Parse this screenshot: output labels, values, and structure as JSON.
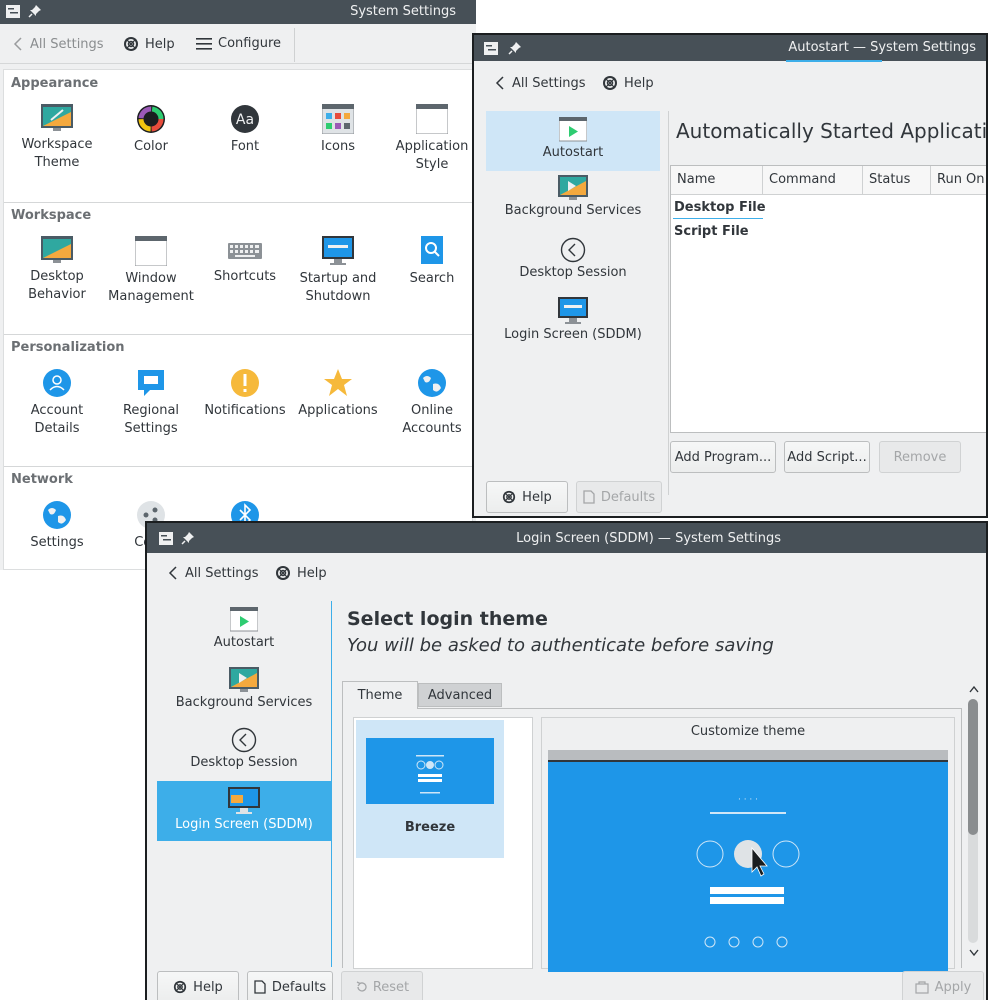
{
  "main_window": {
    "title": "System Settings",
    "toolbar": {
      "back_label": "All Settings",
      "help_label": "Help",
      "configure_label": "Configure"
    },
    "sections": [
      {
        "title": "Appearance",
        "items": [
          {
            "label": "Workspace Theme",
            "icon": "workspace-theme-icon"
          },
          {
            "label": "Color",
            "icon": "color-wheel-icon"
          },
          {
            "label": "Font",
            "icon": "font-icon"
          },
          {
            "label": "Icons",
            "icon": "icons-icon"
          },
          {
            "label": "Application Style",
            "icon": "application-style-icon"
          }
        ]
      },
      {
        "title": "Workspace",
        "items": [
          {
            "label": "Desktop Behavior",
            "icon": "desktop-behavior-icon"
          },
          {
            "label": "Window Management",
            "icon": "window-management-icon"
          },
          {
            "label": "Shortcuts",
            "icon": "keyboard-icon"
          },
          {
            "label": "Startup and Shutdown",
            "icon": "monitor-icon"
          },
          {
            "label": "Search",
            "icon": "search-icon"
          }
        ]
      },
      {
        "title": "Personalization",
        "items": [
          {
            "label": "Account Details",
            "icon": "account-icon"
          },
          {
            "label": "Regional Settings",
            "icon": "chat-flag-icon"
          },
          {
            "label": "Notifications",
            "icon": "notification-icon"
          },
          {
            "label": "Applications",
            "icon": "star-icon"
          },
          {
            "label": "Online Accounts",
            "icon": "globe-icon"
          }
        ]
      },
      {
        "title": "Network",
        "items": [
          {
            "label": "Settings",
            "icon": "network-globe-icon"
          },
          {
            "label": "Conn",
            "icon": "connections-icon"
          },
          {
            "label": "",
            "icon": "bluetooth-icon"
          }
        ]
      }
    ]
  },
  "autostart_window": {
    "title": "Autostart — System Settings",
    "toolbar": {
      "back_label": "All Settings",
      "help_label": "Help"
    },
    "sidebar": [
      {
        "label": "Autostart",
        "icon": "autostart-icon"
      },
      {
        "label": "Background Services",
        "icon": "background-services-icon"
      },
      {
        "label": "Desktop Session",
        "icon": "desktop-session-icon"
      },
      {
        "label": "Login Screen (SDDM)",
        "icon": "login-screen-icon"
      }
    ],
    "heading": "Automatically Started Applications",
    "table": {
      "columns": [
        "Name",
        "Command",
        "Status",
        "Run On"
      ],
      "groups": [
        "Desktop File",
        "Script File"
      ]
    },
    "buttons": {
      "add_program": "Add Program...",
      "add_script": "Add Script...",
      "remove": "Remove",
      "help": "Help",
      "defaults": "Defaults"
    }
  },
  "sddm_window": {
    "title": "Login Screen (SDDM) — System Settings",
    "toolbar": {
      "back_label": "All Settings",
      "help_label": "Help"
    },
    "sidebar": [
      {
        "label": "Autostart",
        "icon": "autostart-icon"
      },
      {
        "label": "Background Services",
        "icon": "background-services-icon"
      },
      {
        "label": "Desktop Session",
        "icon": "desktop-session-icon"
      },
      {
        "label": "Login Screen (SDDM)",
        "icon": "login-screen-icon"
      }
    ],
    "heading": "Select login theme",
    "subheading": "You will be asked to authenticate before saving",
    "tabs": [
      {
        "label": "Theme"
      },
      {
        "label": "Advanced"
      }
    ],
    "theme_name": "Breeze",
    "customize_label": "Customize theme",
    "buttons": {
      "help": "Help",
      "defaults": "Defaults",
      "reset": "Reset",
      "apply": "Apply"
    }
  },
  "colors": {
    "accent": "#3daee9",
    "titlebar": "#475057",
    "window_bg": "#eff0f1",
    "preview_blue": "#1e96e8"
  }
}
